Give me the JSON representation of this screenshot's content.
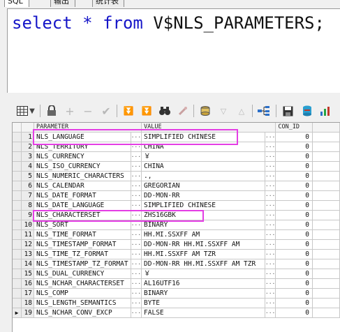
{
  "tabs": [
    {
      "label": "SQL",
      "active": true
    },
    {
      "label": "输出",
      "active": false
    },
    {
      "label": "统计表",
      "active": false
    }
  ],
  "editor": {
    "keyword_select": "select",
    "star": "*",
    "keyword_from": "from",
    "table_name": "V$NLS_PARAMETERS;"
  },
  "toolbar": {
    "icons": [
      "grid-icon",
      "dropdown-arrow-icon",
      "lock-icon",
      "add-record-icon",
      "delete-record-icon",
      "post-check-icon",
      "first-record-icon",
      "last-record-icon",
      "find-binoculars-icon",
      "clear-icon",
      "query-by-example-icon",
      "previous-icon",
      "next-icon",
      "tree-view-icon",
      "save-icon",
      "export-icon",
      "chart-icon"
    ]
  },
  "grid": {
    "columns": [
      "PARAMETER",
      "VALUE",
      "CON_ID"
    ],
    "rows": [
      {
        "n": "1",
        "parameter": "NLS_LANGUAGE",
        "value": "SIMPLIFIED CHINESE",
        "con_id": "0"
      },
      {
        "n": "2",
        "parameter": "NLS_TERRITORY",
        "value": "CHINA",
        "con_id": "0"
      },
      {
        "n": "3",
        "parameter": "NLS_CURRENCY",
        "value": "￥",
        "con_id": "0"
      },
      {
        "n": "4",
        "parameter": "NLS_ISO_CURRENCY",
        "value": "CHINA",
        "con_id": "0"
      },
      {
        "n": "5",
        "parameter": "NLS_NUMERIC_CHARACTERS",
        "value": ".,",
        "con_id": "0"
      },
      {
        "n": "6",
        "parameter": "NLS_CALENDAR",
        "value": "GREGORIAN",
        "con_id": "0"
      },
      {
        "n": "7",
        "parameter": "NLS_DATE_FORMAT",
        "value": "DD-MON-RR",
        "con_id": "0"
      },
      {
        "n": "8",
        "parameter": "NLS_DATE_LANGUAGE",
        "value": "SIMPLIFIED CHINESE",
        "con_id": "0"
      },
      {
        "n": "9",
        "parameter": "NLS_CHARACTERSET",
        "value": "ZHS16GBK",
        "con_id": "0"
      },
      {
        "n": "10",
        "parameter": "NLS_SORT",
        "value": "BINARY",
        "con_id": "0"
      },
      {
        "n": "11",
        "parameter": "NLS_TIME_FORMAT",
        "value": "HH.MI.SSXFF AM",
        "con_id": "0"
      },
      {
        "n": "12",
        "parameter": "NLS_TIMESTAMP_FORMAT",
        "value": "DD-MON-RR HH.MI.SSXFF AM",
        "con_id": "0"
      },
      {
        "n": "13",
        "parameter": "NLS_TIME_TZ_FORMAT",
        "value": "HH.MI.SSXFF AM TZR",
        "con_id": "0"
      },
      {
        "n": "14",
        "parameter": "NLS_TIMESTAMP_TZ_FORMAT",
        "value": "DD-MON-RR HH.MI.SSXFF AM TZR",
        "con_id": "0"
      },
      {
        "n": "15",
        "parameter": "NLS_DUAL_CURRENCY",
        "value": "￥",
        "con_id": "0"
      },
      {
        "n": "16",
        "parameter": "NLS_NCHAR_CHARACTERSET",
        "value": "AL16UTF16",
        "con_id": "0"
      },
      {
        "n": "17",
        "parameter": "NLS_COMP",
        "value": "BINARY",
        "con_id": "0"
      },
      {
        "n": "18",
        "parameter": "NLS_LENGTH_SEMANTICS",
        "value": "BYTE",
        "con_id": "0"
      },
      {
        "n": "19",
        "parameter": "NLS_NCHAR_CONV_EXCP",
        "value": "FALSE",
        "con_id": "0"
      }
    ],
    "current_row": "19"
  },
  "colors": {
    "keyword": "#1515c8",
    "highlight_box": "#e43ee4"
  }
}
